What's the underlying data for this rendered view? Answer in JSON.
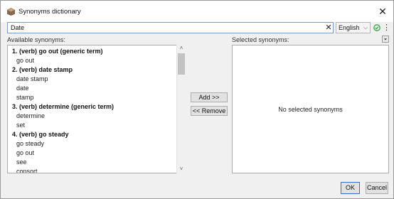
{
  "window": {
    "title": "Synonyms dictionary"
  },
  "search": {
    "value": "Date"
  },
  "language": {
    "selected": "English"
  },
  "left_panel": {
    "label": "Available synonyms:"
  },
  "right_panel": {
    "label": "Selected synonyms:",
    "empty_message": "No selected synonyms"
  },
  "synonyms": {
    "rows": [
      {
        "type": "group",
        "text": "1. (verb) go out (generic term)"
      },
      {
        "type": "item",
        "text": "go out"
      },
      {
        "type": "group",
        "text": "2. (verb) date stamp"
      },
      {
        "type": "item",
        "text": "date stamp"
      },
      {
        "type": "item",
        "text": "date"
      },
      {
        "type": "item",
        "text": "stamp"
      },
      {
        "type": "group",
        "text": "3. (verb) determine (generic term)"
      },
      {
        "type": "item",
        "text": "determine"
      },
      {
        "type": "item",
        "text": "set"
      },
      {
        "type": "group",
        "text": "4. (verb) go steady"
      },
      {
        "type": "item",
        "text": "go steady"
      },
      {
        "type": "item",
        "text": "go out"
      },
      {
        "type": "item",
        "text": "see"
      },
      {
        "type": "item",
        "text": "consort"
      }
    ]
  },
  "buttons": {
    "add": "Add >>",
    "remove": "<< Remove",
    "ok": "OK",
    "cancel": "Cancel"
  },
  "colors": {
    "accent": "#2e6fd6",
    "check": "#2eaa3a"
  },
  "icons": {
    "app": "app-icon",
    "close": "close-icon",
    "clear": "clear-icon",
    "check": "check-circle-icon",
    "more": "more-vertical-icon"
  }
}
